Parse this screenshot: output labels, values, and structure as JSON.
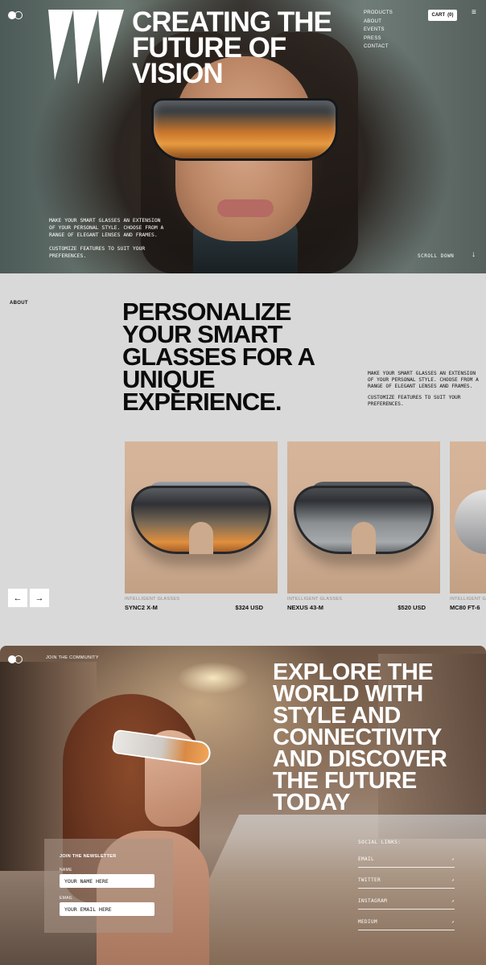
{
  "hero": {
    "title_lines": [
      "CREATING THE",
      "FUTURE OF",
      "VISION"
    ],
    "nav": [
      "PRODUCTS",
      "ABOUT",
      "EVENTS",
      "PRESS",
      "CONTACT"
    ],
    "cart_label": "CART",
    "cart_count": "(0)",
    "copy_1": "MAKE YOUR SMART GLASSES AN EXTENSION OF YOUR PERSONAL STYLE. CHOOSE FROM A RANGE OF ELEGANT LENSES AND FRAMES.",
    "copy_2": "CUSTOMIZE FEATURES TO SUIT YOUR PREFERENCES.",
    "scroll_label": "SCROLL DOWN",
    "scroll_icon": "↓",
    "menu_icon": "≡"
  },
  "about": {
    "label": "ABOUT",
    "title_lines": [
      "PERSONALIZE",
      "YOUR SMART",
      "GLASSES FOR A",
      "UNIQUE",
      "EXPERIENCE."
    ],
    "copy_1": "MAKE YOUR SMART GLASSES AN EXTENSION OF YOUR PERSONAL STYLE. CHOOSE FROM A RANGE OF ELEGANT LENSES AND FRAMES.",
    "copy_2": "CUSTOMIZE FEATURES TO SUIT YOUR PREFERENCES."
  },
  "products": [
    {
      "category": "INTELLIGENT GLASSES",
      "name": "SYNC2 X-M",
      "price": "$324 USD"
    },
    {
      "category": "INTELLIGENT GLASSES",
      "name": "NEXUS 43-M",
      "price": "$520 USD"
    },
    {
      "category": "INTELLIGENT GLASSES",
      "name": "MC80 FT-6",
      "price": ""
    }
  ],
  "carousel": {
    "prev_icon": "←",
    "next_icon": "→"
  },
  "community": {
    "join_label": "JOIN THE COMMUNITY",
    "title_lines": [
      "EXPLORE THE",
      "WORLD WITH",
      "STYLE AND",
      "CONNECTIVITY",
      "AND DISCOVER",
      "THE FUTURE",
      "TODAY"
    ],
    "newsletter": {
      "title": "JOIN THE NEWSLETTER",
      "name_label": "NAME",
      "name_placeholder": "YOUR NAME HERE",
      "email_label": "EMAIL",
      "email_placeholder": "YOUR EMAIL HERE"
    },
    "social_title": "SOCIAL LINKS:",
    "social_links": [
      "EMAIL",
      "TWITTER",
      "INSTAGRAM",
      "MEDIUM"
    ],
    "social_arrow": "↗"
  },
  "colors": {
    "background": "#d9d9d9",
    "text": "#0e0e0e",
    "white": "#ffffff"
  }
}
